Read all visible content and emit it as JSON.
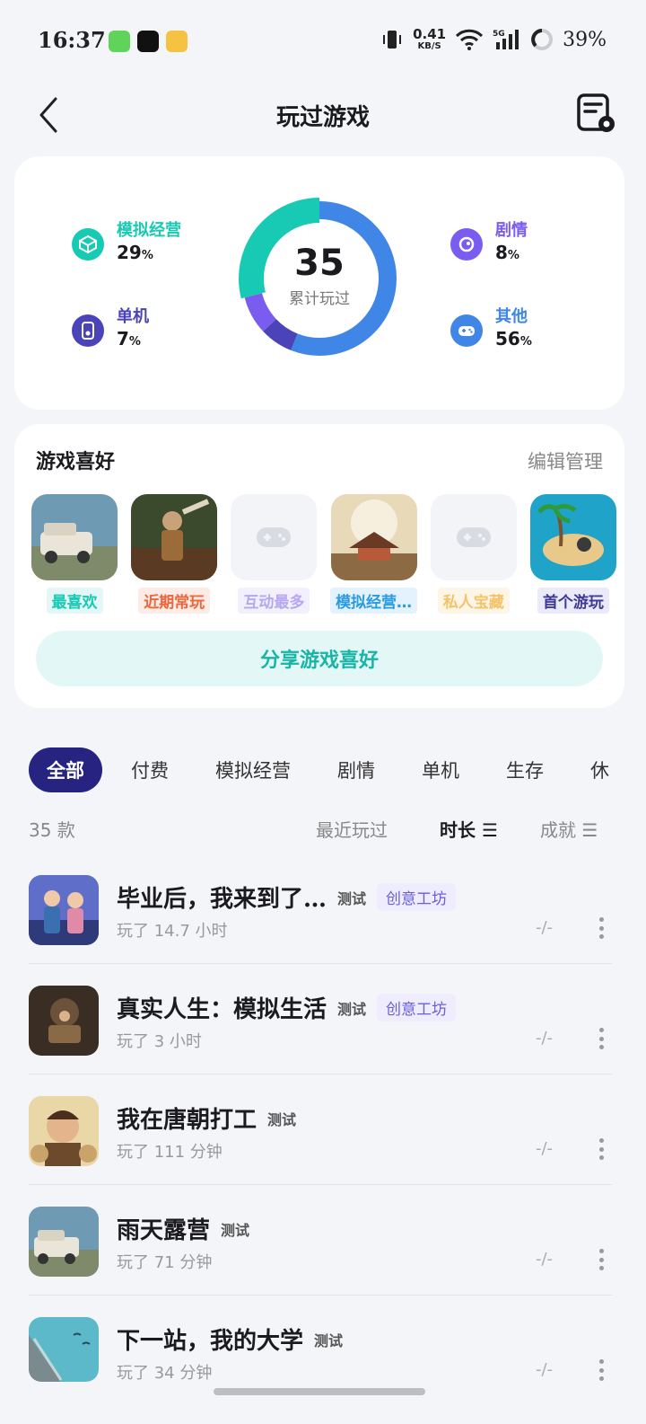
{
  "status": {
    "time": "16:37",
    "net_speed_value": "0.41",
    "net_speed_unit": "KB/S",
    "battery": "39%"
  },
  "header": {
    "title": "玩过游戏",
    "back_icon": "chevron-left-icon",
    "settings_icon": "list-settings-icon"
  },
  "stats": {
    "total": "35",
    "total_label": "累计玩过",
    "items": [
      {
        "label": "模拟经营",
        "value": "29",
        "unit": "%",
        "color": "#18c9b3"
      },
      {
        "label": "单机",
        "value": "7",
        "unit": "%",
        "color": "#4b44b8"
      },
      {
        "label": "剧情",
        "value": "8",
        "unit": "%",
        "color": "#7b5cf0"
      },
      {
        "label": "其他",
        "value": "56",
        "unit": "%",
        "color": "#3f86e6"
      }
    ]
  },
  "preferences": {
    "title": "游戏喜好",
    "edit": "编辑管理",
    "items": [
      {
        "label": "最喜欢",
        "color": "#18c9b3",
        "bg": "#e3f8f6"
      },
      {
        "label": "近期常玩",
        "color": "#f0653b",
        "bg": "#fdece6"
      },
      {
        "label": "互动最多",
        "color": "#b6a8ef",
        "bg": "#f3f0fd"
      },
      {
        "label": "模拟经营…",
        "color": "#2a9be0",
        "bg": "#e3f2fc"
      },
      {
        "label": "私人宝藏",
        "color": "#f3c36a",
        "bg": "#fdf6e6"
      },
      {
        "label": "首个游玩",
        "color": "#3d3899",
        "bg": "#ebeaf8"
      }
    ],
    "share": "分享游戏喜好"
  },
  "tabs": [
    "全部",
    "付费",
    "模拟经营",
    "剧情",
    "单机",
    "生存",
    "休"
  ],
  "sort": {
    "count": "35 款",
    "options": [
      "最近玩过",
      "时长 ☰",
      "成就 ☰"
    ]
  },
  "games": [
    {
      "name": "毕业后，我来到了…",
      "test": "测试",
      "workshop": "创意工坊",
      "time": "玩了 14.7 小时",
      "score": "-/-"
    },
    {
      "name": "真实人生：模拟生活",
      "test": "测试",
      "workshop": "创意工坊",
      "time": "玩了 3 小时",
      "score": "-/-"
    },
    {
      "name": "我在唐朝打工",
      "test": "测试",
      "workshop": "",
      "time": "玩了 111 分钟",
      "score": "-/-"
    },
    {
      "name": "雨天露营",
      "test": "测试",
      "workshop": "",
      "time": "玩了 71 分钟",
      "score": "-/-"
    },
    {
      "name": "下一站，我的大学",
      "test": "测试",
      "workshop": "",
      "time": "玩了 34 分钟",
      "score": "-/-"
    }
  ]
}
